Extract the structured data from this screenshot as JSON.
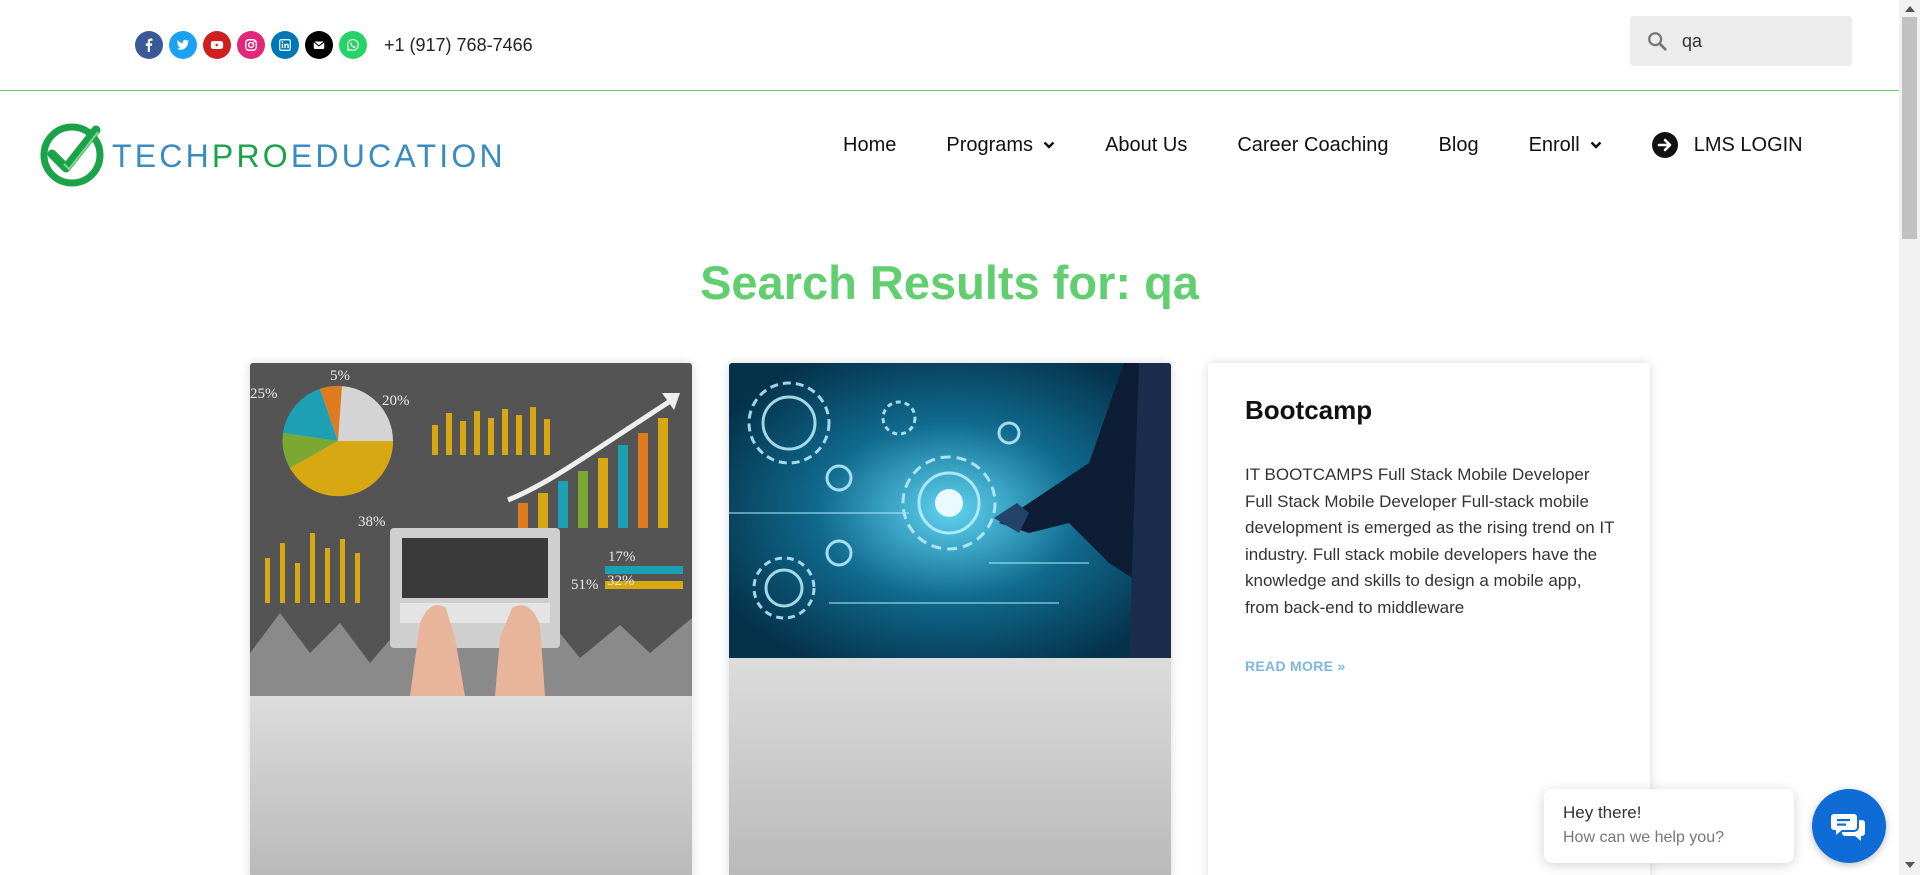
{
  "topbar": {
    "social_icons": [
      "facebook-icon",
      "twitter-icon",
      "youtube-icon",
      "instagram-icon",
      "linkedin-icon",
      "envelope-icon",
      "whatsapp-icon"
    ],
    "phone": "+1 (917) 768-7466",
    "search": {
      "value": "qa"
    }
  },
  "logo": {
    "part1": "TECH",
    "part2": "PRO",
    "part3": "EDUCATION"
  },
  "nav": {
    "home": "Home",
    "programs": "Programs",
    "about": "About Us",
    "career": "Career Coaching",
    "blog": "Blog",
    "enroll": "Enroll",
    "lms": "LMS LOGIN"
  },
  "page_title": "Search Results for: qa",
  "cards": [
    {
      "image": "laptop-analytics-chart-photo"
    },
    {
      "image": "digital-gears-hand-photo"
    },
    {
      "title": "Bootcamp",
      "excerpt": "IT BOOTCAMPS Full Stack Mobile Developer Full Stack Mobile Developer Full-stack mobile development is emerged as the rising trend on IT industry. Full stack mobile developers have the knowledge and skills to design a mobile app, from back-end to middleware",
      "read_more": "READ MORE »"
    }
  ],
  "chat": {
    "greeting": "Hey there!",
    "prompt": "How can we help you?"
  },
  "colors": {
    "accent_green": "#61ce70",
    "logo_blue": "#3a8bbf",
    "chat_blue": "#0f6bd6",
    "read_more": "#7ab8e0"
  }
}
